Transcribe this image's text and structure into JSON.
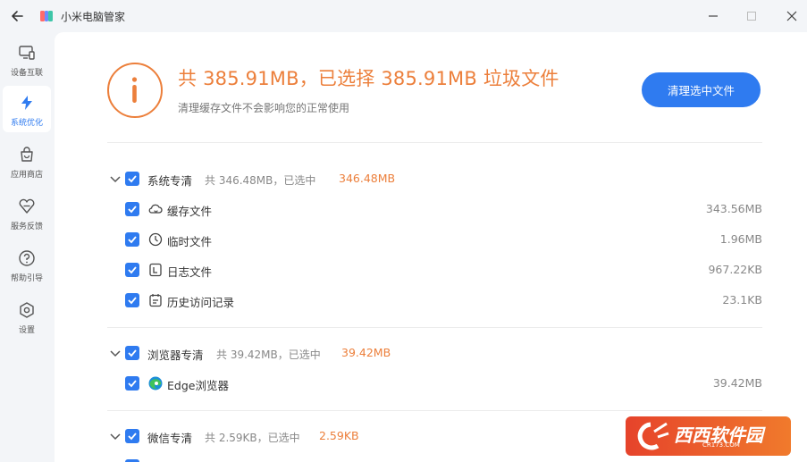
{
  "window": {
    "title": "小米电脑管家"
  },
  "sidebar": {
    "items": [
      {
        "label": "设备互联",
        "icon": "device-link-icon",
        "active": false
      },
      {
        "label": "系统优化",
        "icon": "lightning-icon",
        "active": true
      },
      {
        "label": "应用商店",
        "icon": "store-bag-icon",
        "active": false
      },
      {
        "label": "服务反馈",
        "icon": "heart-feedback-icon",
        "active": false
      },
      {
        "label": "帮助引导",
        "icon": "help-circle-icon",
        "active": false
      },
      {
        "label": "设置",
        "icon": "gear-icon",
        "active": false
      }
    ]
  },
  "summary": {
    "headline": "共 385.91MB，已选择 385.91MB 垃圾文件",
    "subline": "清理缓存文件不会影响您的正常使用",
    "clean_button": "清理选中文件"
  },
  "categories": [
    {
      "name": "系统专清",
      "meta": "共 346.48MB，已选中",
      "selected": "346.48MB",
      "items": [
        {
          "name": "缓存文件",
          "size": "343.56MB",
          "icon": "cache-cloud-icon"
        },
        {
          "name": "临时文件",
          "size": "1.96MB",
          "icon": "clock-icon"
        },
        {
          "name": "日志文件",
          "size": "967.22KB",
          "icon": "log-file-icon"
        },
        {
          "name": "历史访问记录",
          "size": "23.1KB",
          "icon": "history-record-icon"
        }
      ]
    },
    {
      "name": "浏览器专清",
      "meta": "共 39.42MB，已选中",
      "selected": "39.42MB",
      "items": [
        {
          "name": "Edge浏览器",
          "size": "39.42MB",
          "icon": "edge-browser-icon"
        }
      ]
    },
    {
      "name": "微信专清",
      "meta": "共 2.59KB，已选中",
      "selected": "2.59KB",
      "items": []
    }
  ],
  "watermark": {
    "main": "西西软件园",
    "sub": "CR173.COM"
  },
  "colors": {
    "accent": "#2f7bf0",
    "warning": "#ec7f3b"
  }
}
